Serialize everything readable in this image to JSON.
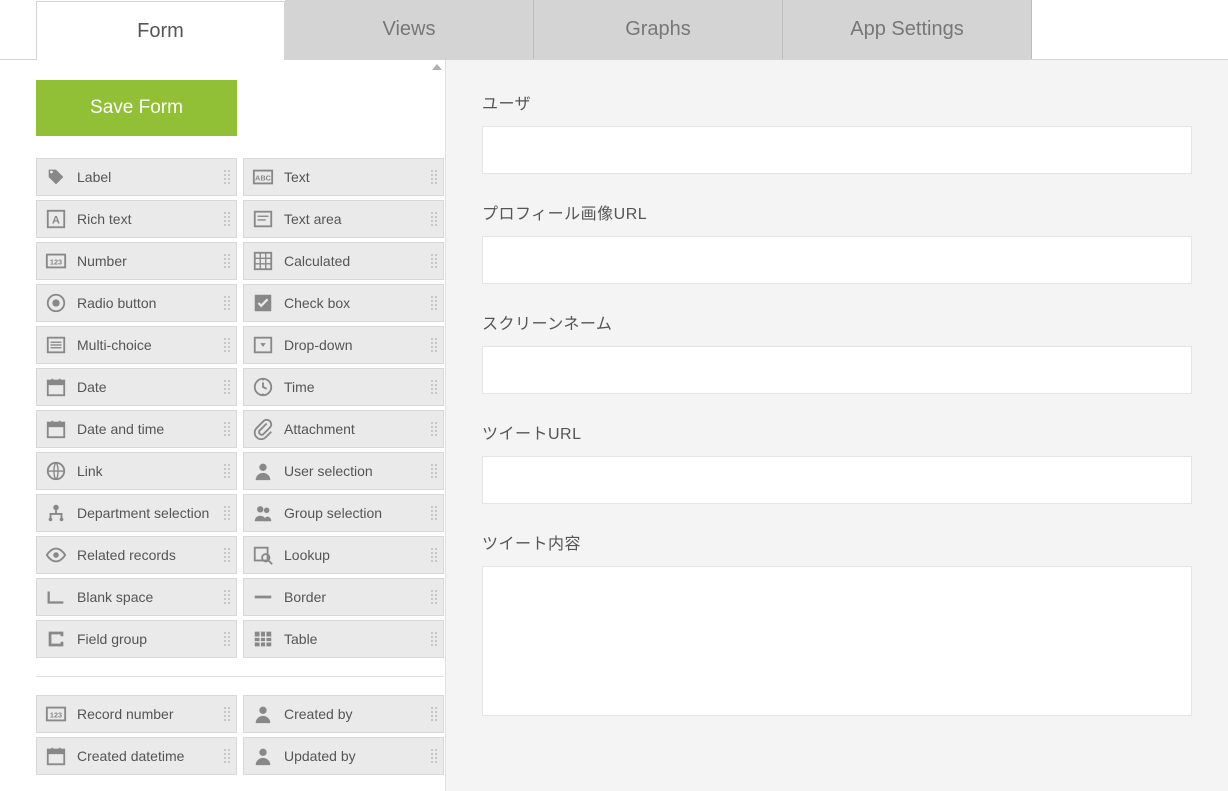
{
  "tabs": [
    {
      "label": "Form",
      "active": true
    },
    {
      "label": "Views",
      "active": false
    },
    {
      "label": "Graphs",
      "active": false
    },
    {
      "label": "App Settings",
      "active": false
    }
  ],
  "save_label": "Save Form",
  "palette_group1": [
    {
      "name": "label",
      "label": "Label",
      "icon": "tag"
    },
    {
      "name": "text",
      "label": "Text",
      "icon": "abc"
    },
    {
      "name": "rich-text",
      "label": "Rich text",
      "icon": "boxed-a"
    },
    {
      "name": "text-area",
      "label": "Text area",
      "icon": "textarea"
    },
    {
      "name": "number",
      "label": "Number",
      "icon": "123"
    },
    {
      "name": "calculated",
      "label": "Calculated",
      "icon": "grid"
    },
    {
      "name": "radio-button",
      "label": "Radio button",
      "icon": "radio"
    },
    {
      "name": "check-box",
      "label": "Check box",
      "icon": "checkbox"
    },
    {
      "name": "multi-choice",
      "label": "Multi-choice",
      "icon": "list"
    },
    {
      "name": "drop-down",
      "label": "Drop-down",
      "icon": "dropdown"
    },
    {
      "name": "date",
      "label": "Date",
      "icon": "calendar"
    },
    {
      "name": "time",
      "label": "Time",
      "icon": "clock"
    },
    {
      "name": "date-and-time",
      "label": "Date and time",
      "icon": "calendar"
    },
    {
      "name": "attachment",
      "label": "Attachment",
      "icon": "clip"
    },
    {
      "name": "link",
      "label": "Link",
      "icon": "globe"
    },
    {
      "name": "user-selection",
      "label": "User selection",
      "icon": "user"
    },
    {
      "name": "department-selection",
      "label": "Department selection",
      "icon": "org"
    },
    {
      "name": "group-selection",
      "label": "Group selection",
      "icon": "users"
    },
    {
      "name": "related-records",
      "label": "Related records",
      "icon": "eye"
    },
    {
      "name": "lookup",
      "label": "Lookup",
      "icon": "lookup"
    },
    {
      "name": "blank-space",
      "label": "Blank space",
      "icon": "blank"
    },
    {
      "name": "border",
      "label": "Border",
      "icon": "border"
    },
    {
      "name": "field-group",
      "label": "Field group",
      "icon": "group"
    },
    {
      "name": "table",
      "label": "Table",
      "icon": "table"
    }
  ],
  "palette_group2": [
    {
      "name": "record-number",
      "label": "Record number",
      "icon": "123"
    },
    {
      "name": "created-by",
      "label": "Created by",
      "icon": "user"
    },
    {
      "name": "created-datetime",
      "label": "Created datetime",
      "icon": "calendar"
    },
    {
      "name": "updated-by",
      "label": "Updated by",
      "icon": "user"
    }
  ],
  "form_fields": [
    {
      "label": "ユーザ",
      "type": "text"
    },
    {
      "label": "プロフィール画像URL",
      "type": "text"
    },
    {
      "label": "スクリーンネーム",
      "type": "text"
    },
    {
      "label": "ツイートURL",
      "type": "text"
    },
    {
      "label": "ツイート内容",
      "type": "textarea"
    }
  ]
}
